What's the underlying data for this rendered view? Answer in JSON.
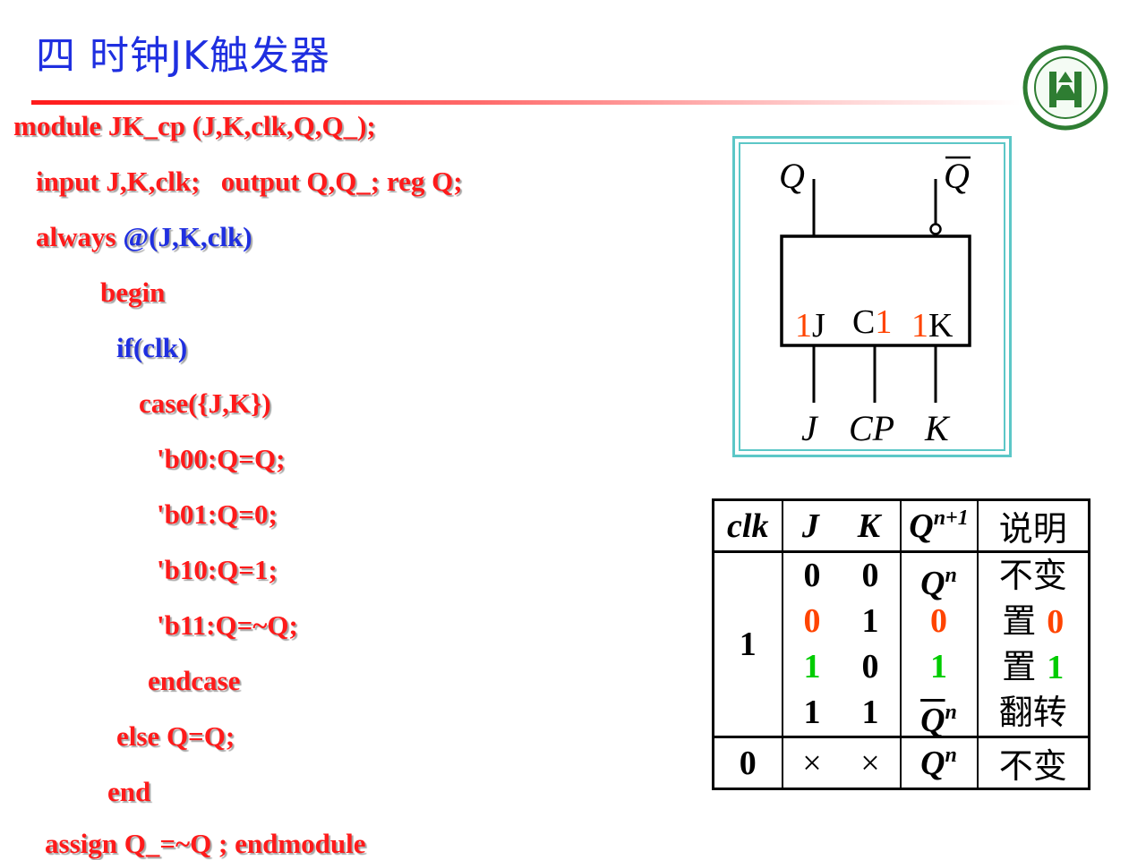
{
  "header": {
    "title": "四 时钟JK触发器"
  },
  "colors": {
    "title": "#1f2fe0",
    "code_red": "#ff1a1a",
    "code_blue": "#1f2fe0",
    "frame": "#5cc7c7",
    "highlight_red": "#ff4400",
    "highlight_green": "#00cc00"
  },
  "logo": {
    "icon": "university-seal-icon"
  },
  "code": {
    "lines": [
      {
        "text": "module JK_cp (J,K,clk,Q,Q_);",
        "color": "red"
      },
      {
        "text": "input J,K,clk;   output Q,Q_; reg Q;",
        "color": "red"
      },
      {
        "text": "always @(J,K,clk)",
        "color": "red"
      },
      {
        "text": "begin",
        "color": "red"
      },
      {
        "text": "if(clk)",
        "color": "blue"
      },
      {
        "text": "case({J,K})",
        "color": "red"
      },
      {
        "text": "'b00:Q=Q;",
        "color": "red"
      },
      {
        "text": "'b01:Q=0;",
        "color": "red"
      },
      {
        "text": "'b10:Q=1;",
        "color": "red"
      },
      {
        "text": "'b11:Q=~Q;",
        "color": "red"
      },
      {
        "text": "endcase",
        "color": "red"
      },
      {
        "text": "else Q=Q;",
        "color": "red"
      },
      {
        "text": "end",
        "color": "red"
      },
      {
        "text": "assign Q_=~Q ; endmodule",
        "color": "red"
      }
    ]
  },
  "symbol": {
    "output_q": "Q",
    "output_qbar": "Q",
    "pin_1j_num": "1",
    "pin_1j_letter": "J",
    "pin_c1_letter": "C",
    "pin_c1_num": "1",
    "pin_1k_num": "1",
    "pin_1k_letter": "K",
    "input_j": "J",
    "input_cp": "CP",
    "input_k": "K"
  },
  "truth_table": {
    "headers": {
      "clk": "clk",
      "j": "J",
      "k": "K",
      "q_base": "Q",
      "q_sup": "n+1",
      "desc": "说明"
    },
    "clk_high": "1",
    "j_values": [
      "0",
      "0",
      "1",
      "1"
    ],
    "k_values": [
      "0",
      "1",
      "0",
      "1"
    ],
    "next_q": [
      {
        "base": "Q",
        "sup": "n"
      },
      {
        "text": "0"
      },
      {
        "text": "1"
      },
      {
        "base": "Q",
        "sup": "n"
      }
    ],
    "desc": [
      {
        "text": "不变"
      },
      {
        "prefix": "置",
        "value": "0"
      },
      {
        "prefix": "置",
        "value": "1"
      },
      {
        "text": "翻转"
      }
    ],
    "clk_low": "0",
    "x_mark": "×",
    "low_q_base": "Q",
    "low_q_sup": "n",
    "low_desc": "不变"
  }
}
